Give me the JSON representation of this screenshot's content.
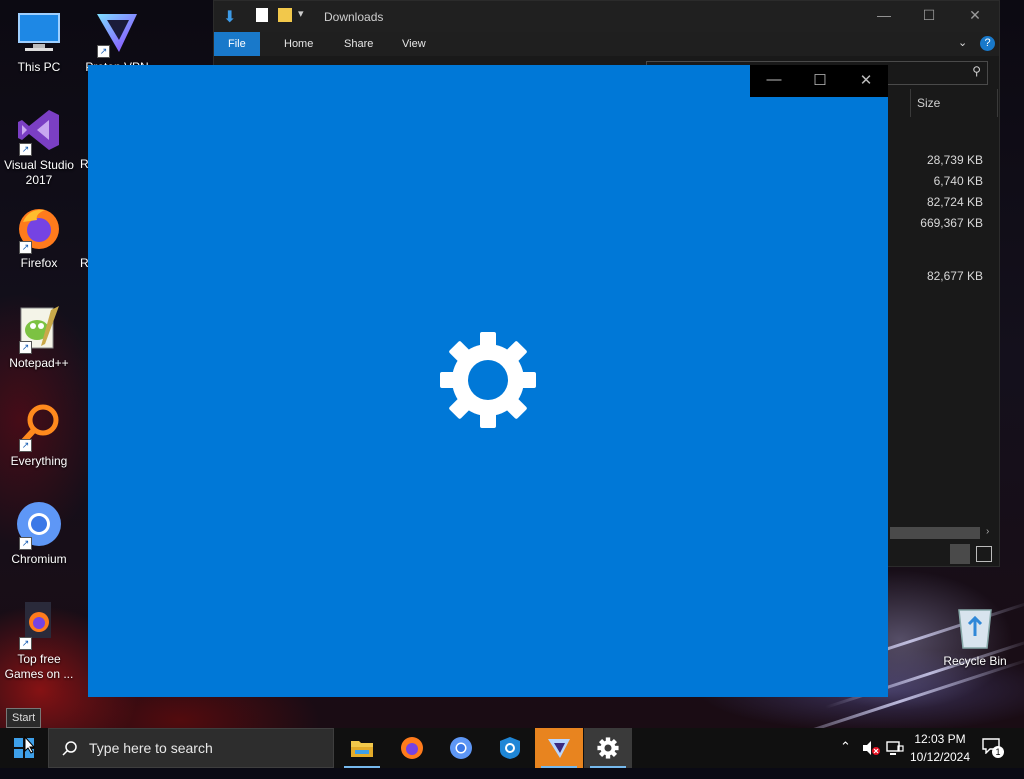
{
  "desktop": {
    "icons": [
      {
        "name": "this-pc",
        "label": "This PC"
      },
      {
        "name": "proton-vpn",
        "label": "Proton VPN"
      },
      {
        "name": "visual-studio",
        "label": "Visual Studio 2017"
      },
      {
        "name": "firefox",
        "label": "Firefox"
      },
      {
        "name": "notepadpp",
        "label": "Notepad++"
      },
      {
        "name": "everything",
        "label": "Everything"
      },
      {
        "name": "chromium",
        "label": "Chromium"
      },
      {
        "name": "top-free-games",
        "label": "Top free Games on ..."
      },
      {
        "name": "recycle-bin",
        "label": "Recycle Bin"
      }
    ],
    "partial_letters": [
      "R",
      "R"
    ]
  },
  "explorer": {
    "title": "Downloads",
    "ribbon_tabs": [
      "File",
      "Home",
      "Share",
      "View"
    ],
    "column_header": "Size",
    "sizes": [
      "28,739 KB",
      "6,740 KB",
      "82,724 KB",
      "669,367 KB",
      "82,677 KB"
    ]
  },
  "settings_window": {
    "background": "#0078d7",
    "icon": "gear-icon"
  },
  "start_tooltip": "Start",
  "taskbar": {
    "search_placeholder": "Type here to search",
    "apps": [
      "file-explorer",
      "firefox",
      "chromium",
      "edge",
      "proton-vpn",
      "settings"
    ],
    "clock_time": "12:03 PM",
    "clock_date": "10/12/2024",
    "notification_count": "1"
  }
}
